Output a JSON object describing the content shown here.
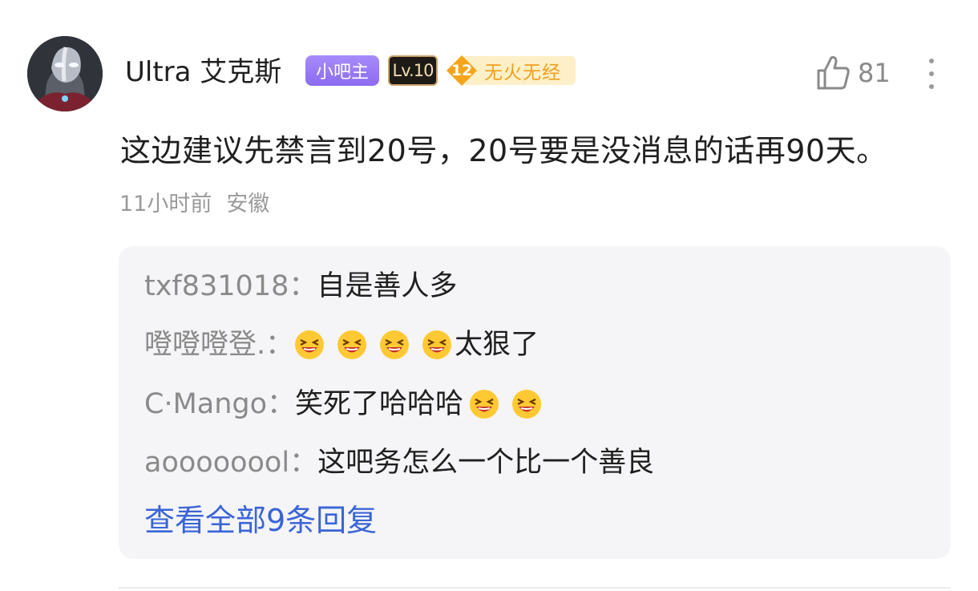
{
  "comment": {
    "username": "Ultra 艾克斯",
    "badges": {
      "owner": "小吧主",
      "level": "Lv.10",
      "fire_level": "12",
      "fire_text": "无火无经"
    },
    "like_count": "81",
    "text": "这边建议先禁言到20号，20号要是没消息的话再90天。",
    "time": "11小时前",
    "location": "安徽"
  },
  "replies": [
    {
      "author": "txf831018：",
      "text": "自是善人多",
      "emoji_before": 0,
      "emoji_after": 0
    },
    {
      "author": "噔噔噔登.：",
      "text": "太狠了",
      "emoji_before": 4,
      "emoji_after": 0
    },
    {
      "author": "C·Mango：",
      "text": "笑死了哈哈哈",
      "emoji_before": 0,
      "emoji_after": 2
    },
    {
      "author": "aoooooool：",
      "text": "这吧务怎么一个比一个善良",
      "emoji_before": 0,
      "emoji_after": 0
    }
  ],
  "view_all_label": "查看全部9条回复",
  "icons": {
    "like": "thumbs-up-icon",
    "more": "more-vertical-icon",
    "emoji": "laughing-face-emoji"
  },
  "colors": {
    "link": "#3a64d8",
    "owner_badge": "#8b6cf0",
    "fire_badge": "#f0a020",
    "reply_bg": "#f5f5f7"
  }
}
